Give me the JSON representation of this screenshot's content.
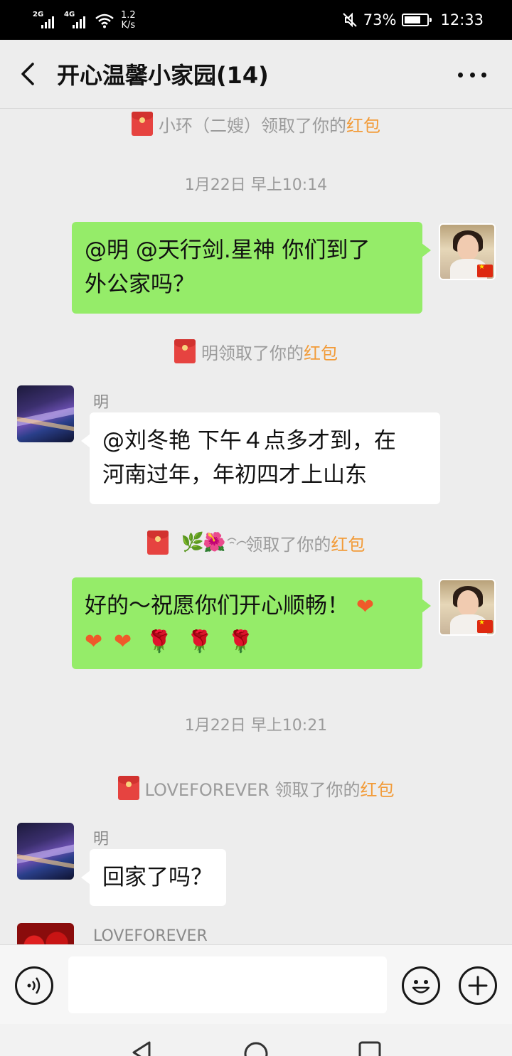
{
  "status_bar": {
    "signal1_label": "2G",
    "signal2_label": "4G",
    "speed_value": "1.2",
    "speed_unit": "K/s",
    "battery": "73%",
    "battery_level": 0.73,
    "time": "12:33"
  },
  "header": {
    "title": "开心温馨小家园(14)"
  },
  "messages": {
    "sys1": {
      "name": "小环（二嫂）领取了你的",
      "link": "红包"
    },
    "time1": "1月22日 早上10:14",
    "msg1": {
      "text_line1": "@明  @天行剑.星神   你们到了",
      "text_line2": "外公家吗？"
    },
    "sys2": {
      "name": "明领取了你的",
      "link": "红包"
    },
    "msg2": {
      "sender": "明",
      "text_line1": "@刘冬艳   下午４点多才到，在",
      "text_line2": "河南过年，年初四才上山东"
    },
    "sys3": {
      "name": "领取了你的",
      "link": "红包"
    },
    "msg3": {
      "text_line1": "好的～祝愿你们开心顺畅！"
    },
    "time2": "1月22日 早上10:21",
    "sys4": {
      "name": "LOVEFOREVER 领取了你的",
      "link": "红包"
    },
    "msg4": {
      "sender": "明",
      "text": "回家了吗？"
    },
    "msg5": {
      "sender": "LOVEFOREVER"
    }
  },
  "colors": {
    "my_bubble": "#95ec69",
    "their_bubble": "#ffffff",
    "highlight": "#f29b38",
    "background": "#ededed"
  },
  "icons": [
    "back-icon",
    "more-icon",
    "red-packet-icon",
    "voice-icon",
    "emoji-icon",
    "plus-icon",
    "heart-icon",
    "rose-icon",
    "leaf-icon",
    "hibiscus-icon",
    "nav-back-icon",
    "nav-home-icon",
    "nav-recents-icon"
  ]
}
